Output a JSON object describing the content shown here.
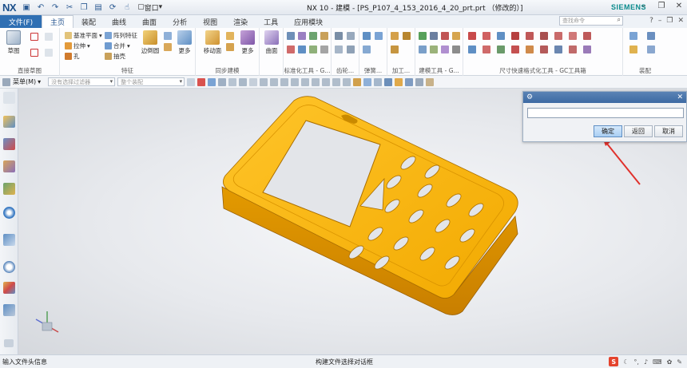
{
  "titlebar": {
    "logo": "NX",
    "window_menu": "窗口",
    "title": "NX 10 - 建模 - [PS_P107_4_153_2016_4_20_prt.prt （修改的）]",
    "brand": "SIEMENS"
  },
  "tabs": {
    "file": "文件(F)",
    "items": [
      "主页",
      "装配",
      "曲线",
      "曲面",
      "分析",
      "视图",
      "渲染",
      "工具",
      "应用模块"
    ],
    "search_placeholder": "查找命令"
  },
  "ribbon": {
    "sketch": "草图",
    "sketch_group": "直接草图",
    "datum_plane": "基准平面",
    "extrude": "拉伸",
    "hole": "孔",
    "pattern_feature": "阵列特征",
    "unite": "合并",
    "shell": "抽壳",
    "edge_blend": "边倒圆",
    "more": "更多",
    "feature_group": "特征",
    "move_face": "移动面",
    "sync_group": "同步建模",
    "surface": "曲面",
    "std_tools_group": "标准化工具 - G...",
    "gear_group": "齿轮...",
    "spring_group": "弹簧...",
    "machining_group": "加工...",
    "model_tools_group": "建模工具 - G...",
    "dim_group": "尺寸快速格式化工具 - GC工具箱",
    "assembly_group": "装配"
  },
  "selbar": {
    "menu": "菜单(M)",
    "filter_placeholder": "没有选择过滤器",
    "scope_placeholder": "整个装配"
  },
  "dialog": {
    "input_value": "",
    "ok": "确定",
    "back": "返回",
    "cancel": "取消"
  },
  "status": {
    "left": "输入文件头信息",
    "center": "构建文件选择对话框",
    "ime": "S"
  },
  "colors": {
    "part": "#f5b400",
    "part_dark": "#d98e00",
    "accent": "#2f6fb3",
    "arrow": "#e0312c"
  }
}
